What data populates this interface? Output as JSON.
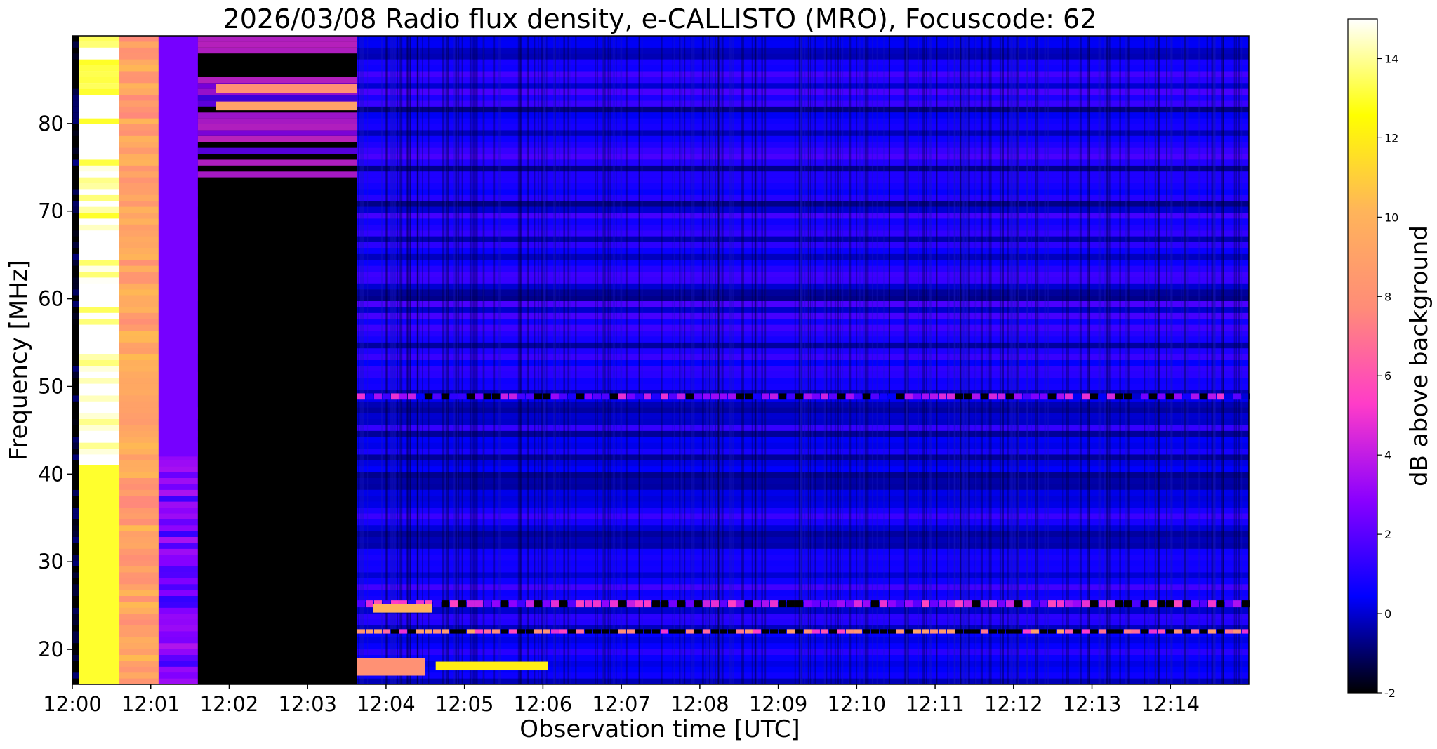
{
  "chart_data": {
    "type": "heatmap",
    "title": "2026/03/08  Radio flux density, e-CALLISTO (MRO), Focuscode: 62",
    "xlabel": "Observation time [UTC]",
    "ylabel": "Frequency [MHz]",
    "colorbar_label": "dB above background",
    "colormap": "gnuplot2",
    "colormap_stops": [
      "#000000",
      "#0000ff",
      "#8a00ff",
      "#ff3cc8",
      "#ff8c78",
      "#ffb45a",
      "#ffff00",
      "#ffffff"
    ],
    "x_range_minutes": [
      0,
      15
    ],
    "y_range_mhz": [
      16,
      90
    ],
    "color_range_db": [
      -2,
      15
    ],
    "x_ticks": [
      "12:00",
      "12:01",
      "12:02",
      "12:03",
      "12:04",
      "12:05",
      "12:06",
      "12:07",
      "12:08",
      "12:09",
      "12:10",
      "12:11",
      "12:12",
      "12:13",
      "12:14"
    ],
    "y_ticks": [
      20,
      30,
      40,
      50,
      60,
      70,
      80
    ],
    "colorbar_ticks": [
      -2,
      0,
      2,
      4,
      6,
      8,
      10,
      12,
      14
    ],
    "time_segments": [
      {
        "start": "12:00:00",
        "end": "12:00:05",
        "level_db": -2
      },
      {
        "start": "12:00:05",
        "end": "12:00:36",
        "level_db": 15
      },
      {
        "start": "12:00:36",
        "end": "12:01:06",
        "level_db": 9
      },
      {
        "start": "12:01:06",
        "end": "12:01:36",
        "level_db": 2.5
      },
      {
        "start": "12:01:36",
        "end": "12:03:38",
        "level_db": -2,
        "bands_above_mhz": 72,
        "band_level_db": 3
      },
      {
        "start": "12:03:38",
        "end": "12:15:00",
        "level_db": 0.5
      }
    ],
    "features": [
      {
        "time_start": "12:00:05",
        "time_end": "12:00:36",
        "freq_mhz": [
          16,
          41
        ],
        "level_db": 13
      },
      {
        "time_start": "12:01:06",
        "time_end": "12:01:36",
        "freq_mhz": [
          42,
          90
        ],
        "level_db": 2.5
      },
      {
        "time_start": "12:01:50",
        "time_end": "12:03:38",
        "freq_mhz": [
          81.5,
          82.5
        ],
        "level_db": 9
      },
      {
        "time_start": "12:01:50",
        "time_end": "12:03:38",
        "freq_mhz": [
          83.5,
          84.5
        ],
        "level_db": 8
      },
      {
        "time_start": "12:03:38",
        "time_end": "12:15:00",
        "freq_mhz": [
          21.8,
          22.3
        ],
        "level_db": 7,
        "pulsed": true
      },
      {
        "time_start": "12:03:38",
        "time_end": "12:15:00",
        "freq_mhz": [
          48.5,
          49.2
        ],
        "level_db": 2.5,
        "pulsed": true
      },
      {
        "time_start": "12:03:38",
        "time_end": "12:15:00",
        "freq_mhz": [
          24.8,
          25.6
        ],
        "level_db": 3.5,
        "pulsed": true
      },
      {
        "time_start": "12:04:38",
        "time_end": "12:06:04",
        "freq_mhz": [
          17.6,
          18.6
        ],
        "level_db": 12
      },
      {
        "time_start": "12:03:38",
        "time_end": "12:04:30",
        "freq_mhz": [
          17.0,
          19.0
        ],
        "level_db": 8
      },
      {
        "time_start": "12:03:50",
        "time_end": "12:04:35",
        "freq_mhz": [
          24.2,
          25.2
        ],
        "level_db": 10
      }
    ],
    "grid": false
  }
}
